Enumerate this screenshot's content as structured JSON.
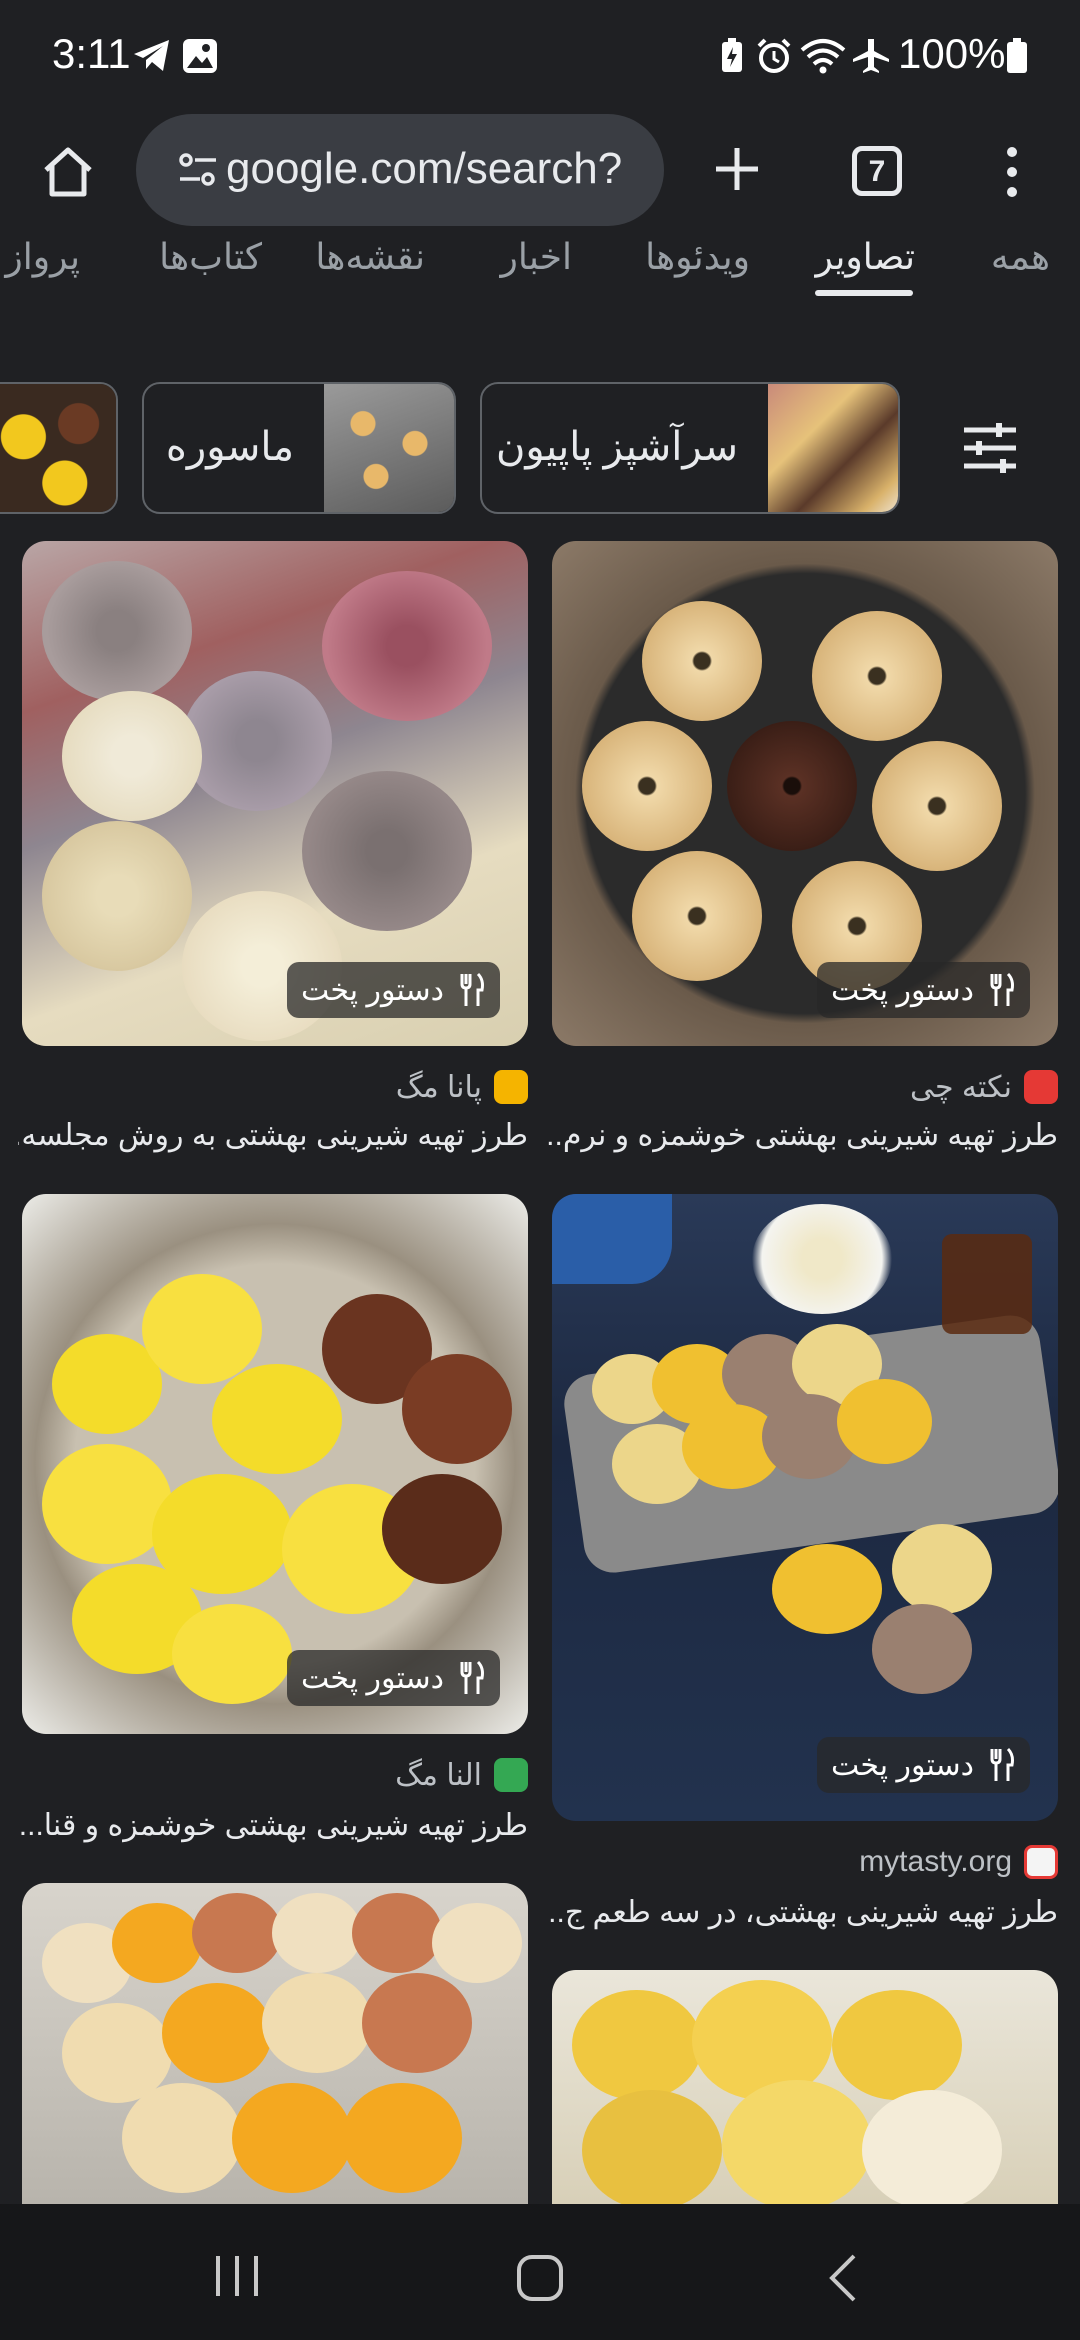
{
  "status": {
    "time": "3:11",
    "battery": "100%",
    "icons": [
      "telegram-icon",
      "gallery-icon",
      "battery-saver-icon",
      "alarm-icon",
      "wifi-icon",
      "airplane-icon",
      "battery-icon"
    ]
  },
  "toolbar": {
    "url": "google.com/search?",
    "tab_count": "7"
  },
  "tabs": [
    {
      "label": "همه",
      "active": false
    },
    {
      "label": "تصاویر",
      "active": true
    },
    {
      "label": "ویدئوها",
      "active": false
    },
    {
      "label": "اخبار",
      "active": false
    },
    {
      "label": "نقشه‌ها",
      "active": false
    },
    {
      "label": "کتاب‌ها",
      "active": false
    },
    {
      "label": "پرواز",
      "active": false
    }
  ],
  "chips": [
    {
      "label": "سرآشپز پاپیون"
    },
    {
      "label": "ماسوره"
    }
  ],
  "results": [
    {
      "badge": "دستور پخت",
      "source": "نکته چی",
      "caption": "طرز تهیه شیرینی بهشتی خوشمزه و نرم..."
    },
    {
      "badge": "دستور پخت",
      "source": "پانا مگ",
      "caption": "طرز تهیه شیرینی بهشتی به روش مجلسه..."
    },
    {
      "badge": "دستور پخت",
      "source": "mytasty.org",
      "caption": "طرز تهیه شیرینی بهشتی، در سه طعم ج..."
    },
    {
      "badge": "دستور پخت",
      "source": "النا مگ",
      "caption": "طرز تهیه شیرینی بهشتی خوشمزه و قنا..."
    }
  ],
  "colors": {
    "background": "#1f2023",
    "url_bar": "#3a3d43",
    "text_primary": "#e8eaed",
    "text_secondary": "#9aa0a6"
  }
}
